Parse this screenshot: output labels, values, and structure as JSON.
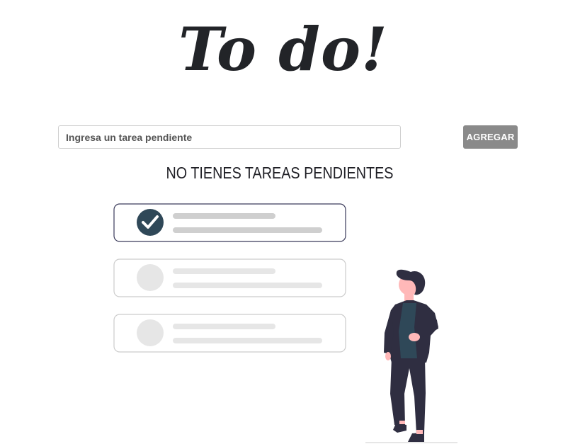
{
  "app": {
    "title": "To do!"
  },
  "form": {
    "input_placeholder": "Ingresa un tarea pendiente",
    "input_value": "",
    "add_button_label": "AGREGAR"
  },
  "empty_state": {
    "message": "NO TIENES TAREAS PENDIENTES",
    "illustration": "person-with-checklist",
    "checklist_items": [
      {
        "checked": true
      },
      {
        "checked": false
      },
      {
        "checked": false
      }
    ]
  },
  "colors": {
    "title": "#222428",
    "button_bg": "#8a8a8a",
    "check_fill": "#2f4858",
    "placeholder_bar_dark": "#cfcfcf",
    "placeholder_bar_light": "#e6e6e6",
    "person_clothes": "#2f2e41",
    "person_shirt": "#2f4858",
    "person_skin": "#ffb8b8"
  }
}
